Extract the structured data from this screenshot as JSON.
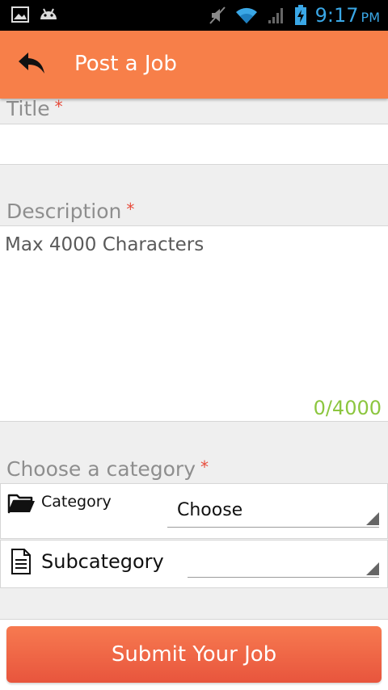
{
  "status_bar": {
    "time": "9:17",
    "ampm": "PM",
    "time_color": "#3aa7e6",
    "icons": [
      "image-icon",
      "android-icon",
      "mute-icon",
      "wifi-icon",
      "signal-icon",
      "battery-charging-icon"
    ]
  },
  "app_bar": {
    "title": "Post a Job",
    "back_icon": "back-arrow-icon",
    "color": "#f77f49"
  },
  "form": {
    "title_label": "Title",
    "title_value": "",
    "required_mark": "*",
    "description_label": "Description",
    "description_placeholder": "Max 4000 Characters",
    "description_counter": "0/4000",
    "category_section_label": "Choose a category",
    "category": {
      "icon": "folder-icon",
      "label": "Category",
      "selected": "Choose"
    },
    "subcategory": {
      "icon": "document-icon",
      "label": "Subcategory",
      "selected": ""
    },
    "submit_label": "Submit Your Job"
  },
  "colors": {
    "accent": "#f77f49",
    "required": "#e74c3c",
    "counter": "#8cc63f",
    "button": "#ef6a47"
  }
}
